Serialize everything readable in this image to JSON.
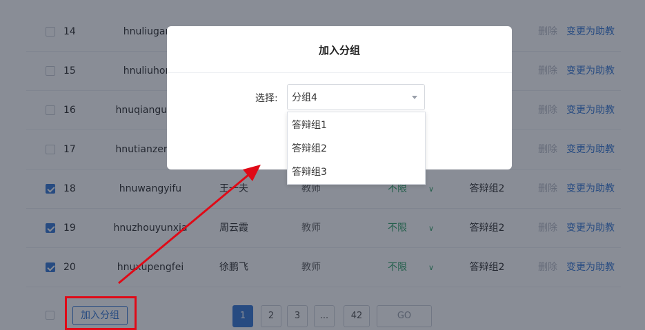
{
  "table": {
    "rows": [
      {
        "checked": false,
        "index": "14",
        "username": "hnuliugang",
        "name": "",
        "role": "",
        "limit": "",
        "group": "",
        "delete": "删除",
        "change": "变更为助教"
      },
      {
        "checked": false,
        "index": "15",
        "username": "hnuliuhong",
        "name": "",
        "role": "",
        "limit": "",
        "group": "",
        "delete": "删除",
        "change": "变更为助教"
      },
      {
        "checked": false,
        "index": "16",
        "username": "hnuqianguang",
        "name": "",
        "role": "",
        "limit": "",
        "group": "",
        "delete": "删除",
        "change": "变更为助教"
      },
      {
        "checked": false,
        "index": "17",
        "username": "hnutianzerong",
        "name": "",
        "role": "",
        "limit": "",
        "group": "",
        "delete": "删除",
        "change": "变更为助教"
      },
      {
        "checked": true,
        "index": "18",
        "username": "hnuwangyifu",
        "name": "王一夫",
        "role": "教师",
        "limit": "不限",
        "group": "答辩组2",
        "delete": "删除",
        "change": "变更为助教"
      },
      {
        "checked": true,
        "index": "19",
        "username": "hnuzhouyunxia",
        "name": "周云霞",
        "role": "教师",
        "limit": "不限",
        "group": "答辩组2",
        "delete": "删除",
        "change": "变更为助教"
      },
      {
        "checked": true,
        "index": "20",
        "username": "hnuxupengfei",
        "name": "徐鹏飞",
        "role": "教师",
        "limit": "不限",
        "group": "答辩组2",
        "delete": "删除",
        "change": "变更为助教"
      }
    ]
  },
  "footer": {
    "join_group_label": "加入分组",
    "pages": [
      "1",
      "2",
      "3",
      "...",
      "42"
    ],
    "active_page": "1",
    "go_label": "GO"
  },
  "modal": {
    "title": "加入分组",
    "select_label": "选择:",
    "select_value": "分组4",
    "options": [
      "答辩组1",
      "答辩组2",
      "答辩组3"
    ]
  },
  "colors": {
    "accent": "#3a7bd5",
    "limit_green": "#35a36b",
    "annotation_red": "#e00a17"
  },
  "icons": {
    "limit_chevron": "chevron-down-icon",
    "select_caret": "caret-down-icon",
    "checkbox_checked": "check-icon"
  }
}
